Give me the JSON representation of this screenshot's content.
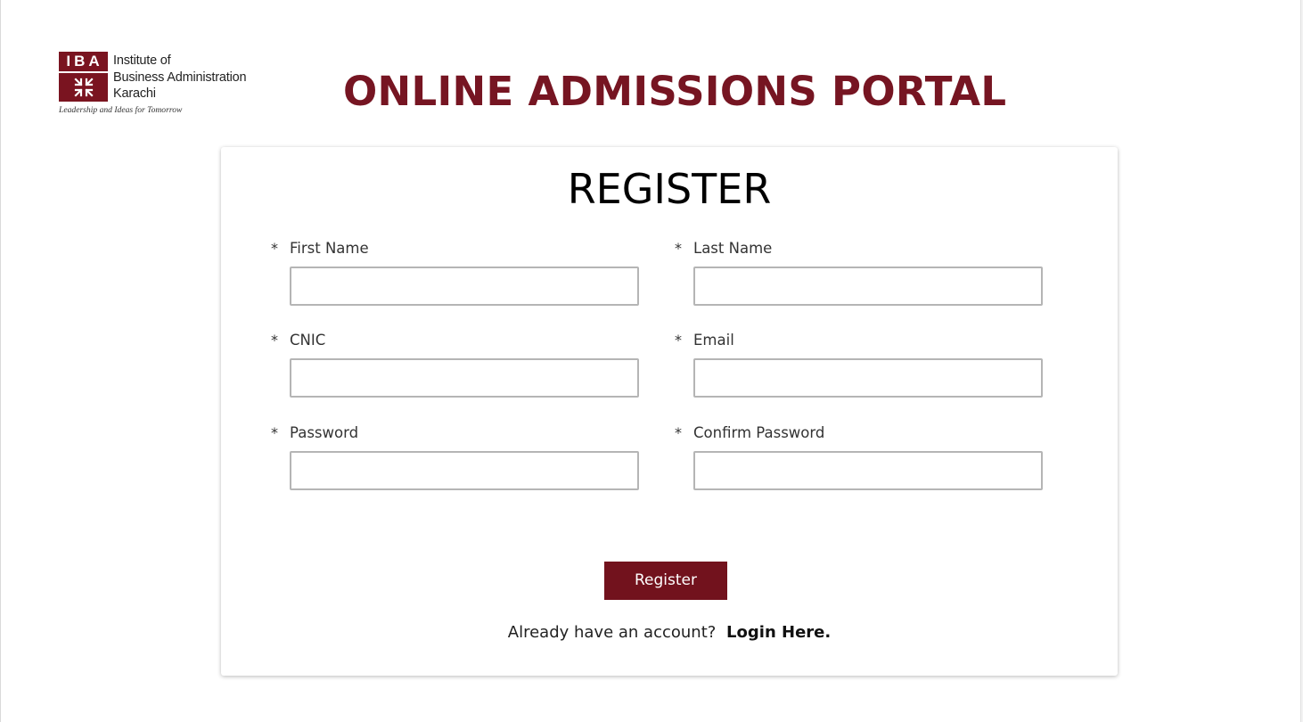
{
  "brand": {
    "logo_abbr": "IBA",
    "logo_lines": [
      "Institute of",
      "Business Administration",
      "Karachi"
    ],
    "tagline": "Leadership and Ideas for Tomorrow",
    "color": "#761522"
  },
  "header": {
    "title": "ONLINE ADMISSIONS PORTAL"
  },
  "form": {
    "title": "REGISTER",
    "required_marker": "*",
    "fields": {
      "first_name": {
        "label": "First Name",
        "value": "",
        "placeholder": ""
      },
      "last_name": {
        "label": "Last Name",
        "value": "",
        "placeholder": ""
      },
      "cnic": {
        "label": "CNIC",
        "value": "",
        "placeholder": ""
      },
      "email": {
        "label": "Email",
        "value": "",
        "placeholder": ""
      },
      "password": {
        "label": "Password",
        "value": "",
        "placeholder": ""
      },
      "confirm_password": {
        "label": "Confirm Password",
        "value": "",
        "placeholder": ""
      }
    },
    "submit_label": "Register",
    "login_prompt": "Already have an account?",
    "login_link": "Login Here."
  }
}
